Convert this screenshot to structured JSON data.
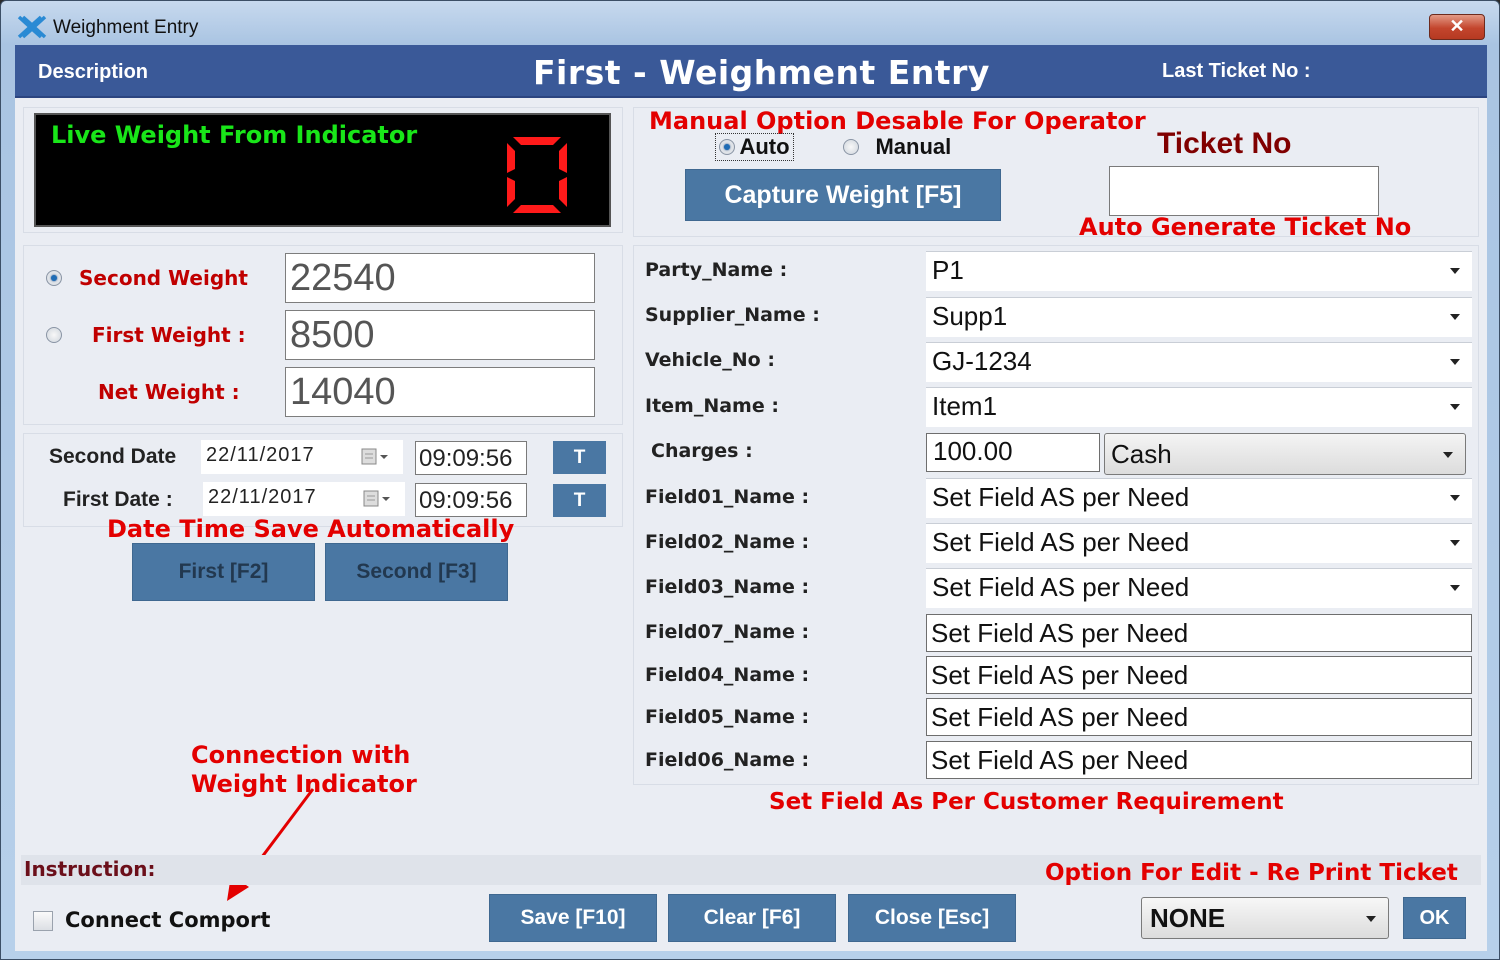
{
  "window": {
    "title": "Weighment Entry",
    "close_glyph": "✕"
  },
  "header": {
    "description_label": "Description",
    "title": "First - Weighment Entry",
    "last_ticket_label": "Last Ticket No :",
    "last_ticket_value": ""
  },
  "indicator": {
    "label": "Live Weight From Indicator",
    "value": "0",
    "label_color": "#19e619",
    "digit_color": "#ff1a1a"
  },
  "capture": {
    "annotation": "Manual Option Desable For Operator",
    "mode_options": [
      {
        "label": "Auto",
        "selected": true
      },
      {
        "label": "Manual",
        "selected": false
      }
    ],
    "capture_button": "Capture Weight [F5]"
  },
  "ticket": {
    "title": "Ticket No",
    "value": "",
    "annotation": "Auto Generate Ticket No"
  },
  "weights": {
    "second": {
      "label": "Second Weight",
      "value": "22540",
      "selected": true
    },
    "first": {
      "label": "First Weight :",
      "value": "8500",
      "selected": false
    },
    "net": {
      "label": "Net Weight  :",
      "value": "14040"
    }
  },
  "dates": {
    "second": {
      "label": "Second Date",
      "date": "22/11/2017",
      "time": "09:09:56",
      "t_button": "T"
    },
    "first": {
      "label": "First Date :",
      "date": "22/11/2017",
      "time": "09:09:56",
      "t_button": "T"
    },
    "annotation": "Date Time Save Automatically"
  },
  "weigh_buttons": {
    "first": "First [F2]",
    "second": "Second [F3]"
  },
  "form": {
    "combos": [
      {
        "label": "Party_Name :",
        "value": "P1"
      },
      {
        "label": "Supplier_Name :",
        "value": "Supp1"
      },
      {
        "label": "Vehicle_No :",
        "value": "GJ-1234"
      },
      {
        "label": "Item_Name :",
        "value": "Item1"
      }
    ],
    "charges": {
      "label": "Charges :",
      "amount": "100.00",
      "payment_mode": "Cash"
    },
    "field_combos": [
      {
        "label": "Field01_Name :",
        "value": "Set Field AS per Need"
      },
      {
        "label": "Field02_Name :",
        "value": "Set Field AS per Need"
      },
      {
        "label": "Field03_Name :",
        "value": "Set Field AS per Need"
      }
    ],
    "field_texts": [
      {
        "label": "Field07_Name :",
        "value": "Set Field AS per Need"
      },
      {
        "label": "Field04_Name :",
        "value": "Set Field AS per Need"
      },
      {
        "label": "Field05_Name :",
        "value": "Set Field AS per Need"
      },
      {
        "label": "Field06_Name :",
        "value": "Set Field AS per Need"
      }
    ],
    "annotation": "Set Field As Per Customer Requirement"
  },
  "connection": {
    "annotation_line1": "Connection with",
    "annotation_line2": "Weight Indicator",
    "checkbox_label": "Connect Comport",
    "checked": false
  },
  "instruction": {
    "label": "Instruction:"
  },
  "footer": {
    "save": "Save [F10]",
    "clear": "Clear [F6]",
    "close": "Close [Esc]",
    "edit_annotation": "Option For Edit - Re Print Ticket",
    "edit_mode": "NONE",
    "ok": "OK"
  },
  "colors": {
    "header_bg": "#3a5998",
    "button_bg": "#4a77a3",
    "annotation": "#e30000",
    "weight_label": "#c00000",
    "ticket_title": "#800000"
  }
}
